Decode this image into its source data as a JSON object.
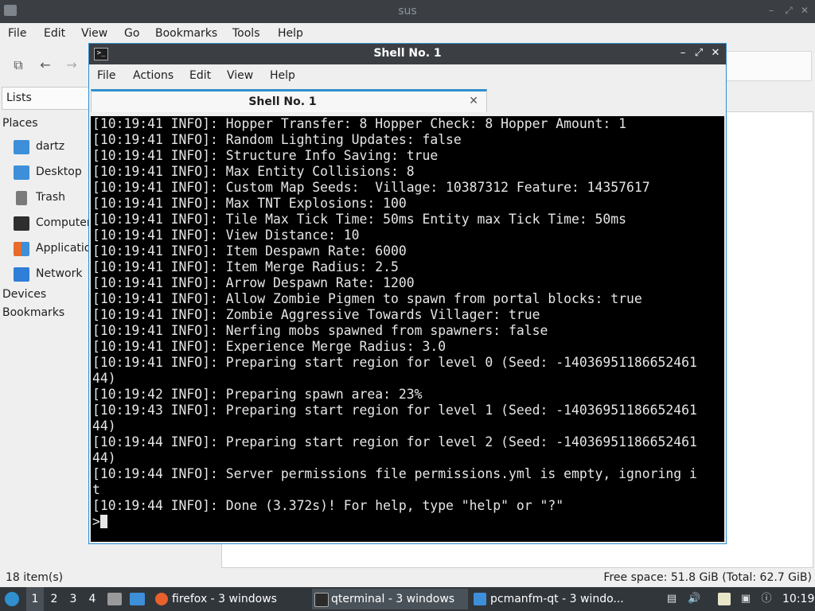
{
  "file_manager": {
    "window_title": "sus",
    "menu": [
      "File",
      "Edit",
      "View",
      "Go",
      "Bookmarks",
      "Tools",
      "Help"
    ],
    "side_mode": "Lists",
    "sections": {
      "places": "Places",
      "devices": "Devices",
      "bookmarks": "Bookmarks"
    },
    "places": [
      {
        "label": "dartz",
        "icon": "home-folder-icon",
        "color": "#3d8fd9"
      },
      {
        "label": "Desktop",
        "icon": "desktop-folder-icon",
        "color": "#3d8fd9"
      },
      {
        "label": "Trash",
        "icon": "trash-icon",
        "color": "#6b6b6b"
      },
      {
        "label": "Computer",
        "icon": "computer-icon",
        "color": "#2e2e2e"
      },
      {
        "label": "Applications",
        "icon": "applications-icon",
        "color": "#e86b2b"
      },
      {
        "label": "Network",
        "icon": "network-icon",
        "color": "#2f7ed8"
      }
    ],
    "status_left": "18 item(s)",
    "status_right": "Free space: 51.8 GiB (Total: 62.7 GiB)"
  },
  "terminal": {
    "window_title": "Shell No. 1",
    "menu": [
      "File",
      "Actions",
      "Edit",
      "View",
      "Help"
    ],
    "tab_label": "Shell No. 1",
    "lines": [
      "[10:19:41 INFO]: Hopper Transfer: 8 Hopper Check: 8 Hopper Amount: 1",
      "[10:19:41 INFO]: Random Lighting Updates: false",
      "[10:19:41 INFO]: Structure Info Saving: true",
      "[10:19:41 INFO]: Max Entity Collisions: 8",
      "[10:19:41 INFO]: Custom Map Seeds:  Village: 10387312 Feature: 14357617",
      "[10:19:41 INFO]: Max TNT Explosions: 100",
      "[10:19:41 INFO]: Tile Max Tick Time: 50ms Entity max Tick Time: 50ms",
      "[10:19:41 INFO]: View Distance: 10",
      "[10:19:41 INFO]: Item Despawn Rate: 6000",
      "[10:19:41 INFO]: Item Merge Radius: 2.5",
      "[10:19:41 INFO]: Arrow Despawn Rate: 1200",
      "[10:19:41 INFO]: Allow Zombie Pigmen to spawn from portal blocks: true",
      "[10:19:41 INFO]: Zombie Aggressive Towards Villager: true",
      "[10:19:41 INFO]: Nerfing mobs spawned from spawners: false",
      "[10:19:41 INFO]: Experience Merge Radius: 3.0",
      "[10:19:41 INFO]: Preparing start region for level 0 (Seed: -14036951186652461",
      "44)",
      "[10:19:42 INFO]: Preparing spawn area: 23%",
      "[10:19:43 INFO]: Preparing start region for level 1 (Seed: -14036951186652461",
      "44)",
      "[10:19:44 INFO]: Preparing start region for level 2 (Seed: -14036951186652461",
      "44)",
      "[10:19:44 INFO]: Server permissions file permissions.yml is empty, ignoring i",
      "t",
      "[10:19:44 INFO]: Done (3.372s)! For help, type \"help\" or \"?\""
    ],
    "prompt": ">"
  },
  "taskbar": {
    "workspaces": [
      "1",
      "2",
      "3",
      "4"
    ],
    "tasks": [
      {
        "label": "firefox - 3 windows",
        "icon": "firefox-icon",
        "color": "#e8602c"
      },
      {
        "label": "qterminal - 3 windows",
        "icon": "terminal-icon",
        "color": "#2b2b2b"
      },
      {
        "label": "pcmanfm-qt - 3 windo...",
        "icon": "folder-icon",
        "color": "#3d8fd9"
      }
    ],
    "clock": "10:19"
  },
  "colors": {
    "accent": "#2f8fcf",
    "titlebar": "#3b3f44",
    "panel": "#31363b",
    "terminal_bg": "#000000"
  }
}
